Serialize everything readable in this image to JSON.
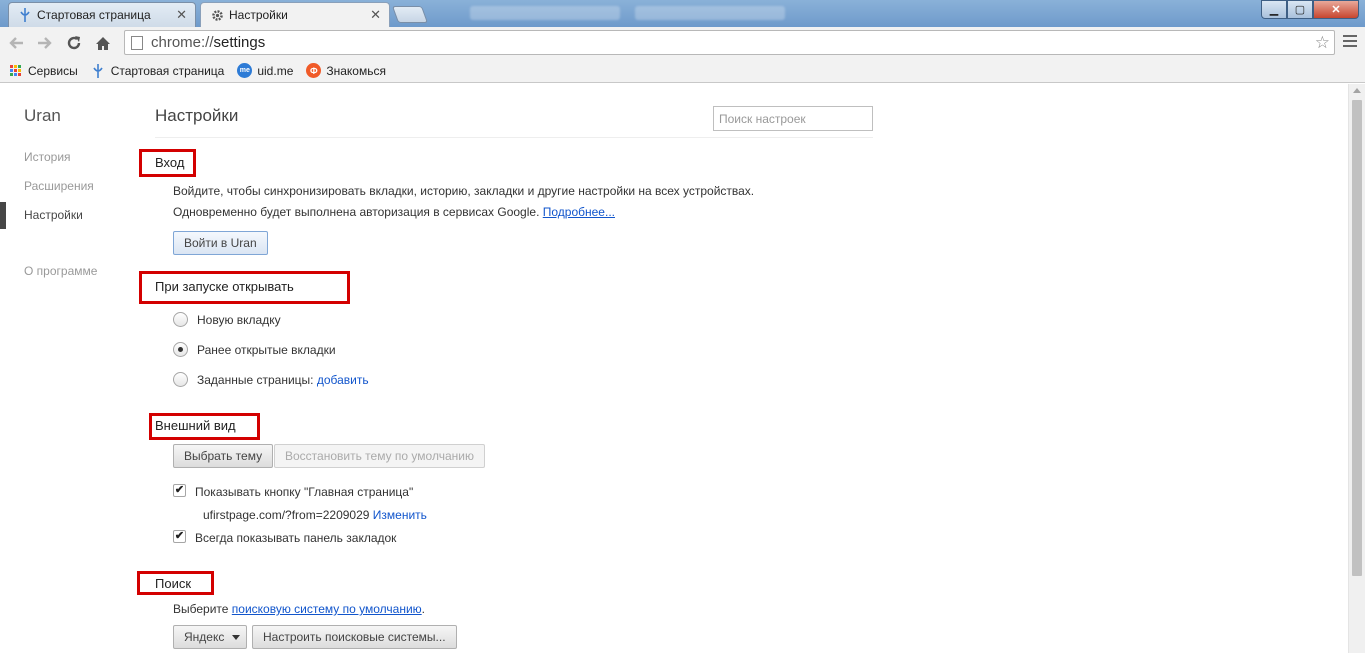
{
  "browser": {
    "tabs": [
      {
        "title": "Стартовая страница",
        "close": "✕"
      },
      {
        "title": "Настройки",
        "close": "✕"
      }
    ],
    "address": {
      "scheme": "chrome://",
      "host": "settings"
    },
    "window_buttons": {
      "minimize": "▁",
      "maximize": "▢",
      "close": "✕"
    },
    "bookmarks": [
      "Сервисы",
      "Стартовая страница",
      "uid.me",
      "Знакомься"
    ],
    "bookmark_icon_text": {
      "uid": "me",
      "znak": "Ф"
    },
    "colors": {
      "highlight": "#d30000",
      "link": "#1155cc",
      "titlebar": "#7ea6d2"
    }
  },
  "sidebar": {
    "brand": "Uran",
    "items": [
      "История",
      "Расширения",
      "Настройки",
      "О программе"
    ],
    "selected": "Настройки"
  },
  "main": {
    "title": "Настройки",
    "search_placeholder": "Поиск настроек",
    "signin": {
      "title": "Вход",
      "line1": "Войдите, чтобы синхронизировать вкладки, историю, закладки и другие настройки на всех устройствах.",
      "line2": "Одновременно будет выполнена авторизация в сервисах Google.",
      "more_link": "Подробнее...",
      "button": "Войти в Uran"
    },
    "startup": {
      "title": "При запуске открывать",
      "options": [
        "Новую вкладку",
        "Ранее открытые вкладки",
        "Заданные страницы:"
      ],
      "selected_index": 1,
      "add_link": "добавить"
    },
    "appearance": {
      "title": "Внешний вид",
      "choose_theme": "Выбрать тему",
      "reset_theme": "Восстановить тему по умолчанию",
      "show_home": "Показывать кнопку \"Главная страница\"",
      "show_home_checked": true,
      "home_url": "ufirstpage.com/?from=2209029",
      "change_link": "Изменить",
      "show_bookmarks": "Всегда показывать панель закладок",
      "show_bookmarks_checked": true,
      "check_mark": "✔"
    },
    "search": {
      "title": "Поиск",
      "text": "Выберите",
      "link": "поисковую систему по умолчанию",
      "period": ".",
      "engine": "Яндекс",
      "manage": "Настроить поисковые системы..."
    }
  }
}
